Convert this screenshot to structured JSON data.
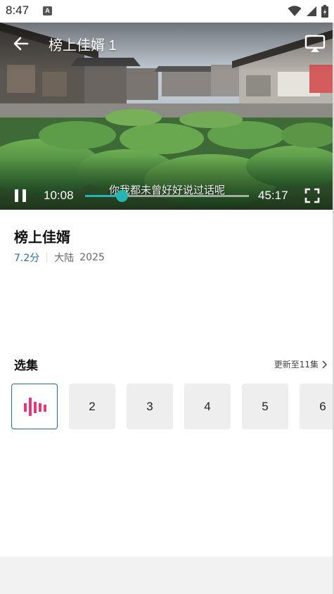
{
  "status_bar": {
    "time": "8:47",
    "notification_letter": "A"
  },
  "player": {
    "title": "榜上佳婿 1",
    "subtitle": "你我都未曾好好说过话呢",
    "current_time": "10:08",
    "total_time": "45:17",
    "progress_fraction": 0.223,
    "accent_color": "#26b5b5"
  },
  "show": {
    "title": "榜上佳婿",
    "rating": "7.2分",
    "region": "大陆",
    "year": "2025"
  },
  "episodes": {
    "header": "选集",
    "update_text": "更新至11集",
    "items": [
      {
        "label": "",
        "playing": true
      },
      {
        "label": "2"
      },
      {
        "label": "3"
      },
      {
        "label": "4"
      },
      {
        "label": "5"
      },
      {
        "label": "6"
      }
    ],
    "playing_icon_color": "#e8357d"
  },
  "icons": {
    "back": "arrow-left-icon",
    "cast": "cast-icon",
    "pause": "pause-icon",
    "fullscreen": "fullscreen-icon",
    "chevron": "chevron-right-icon"
  }
}
